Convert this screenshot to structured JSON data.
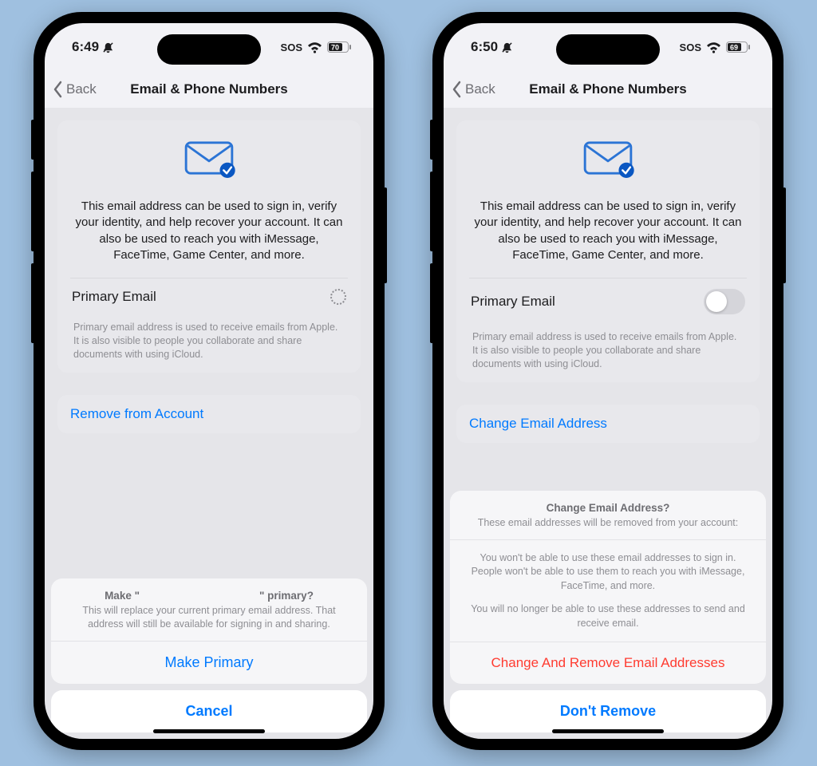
{
  "left": {
    "status": {
      "time": "6:49",
      "sos": "SOS",
      "battery": "70"
    },
    "nav": {
      "back": "Back",
      "title": "Email & Phone Numbers"
    },
    "card": {
      "desc": "This email address can be used to sign in, verify your identity, and help recover your account. It can also be used to reach you with iMessage, FaceTime, Game Center, and more.",
      "row_label": "Primary Email",
      "footer": "Primary email address is used to receive emails from Apple. It is also visible to people you collaborate and share documents with using iCloud."
    },
    "link": "Remove from Account",
    "sheet": {
      "title": "Make \"                                        \" primary?",
      "sub": "This will replace your current primary email address. That address will still be available for signing in and sharing.",
      "confirm": "Make Primary",
      "cancel": "Cancel"
    }
  },
  "right": {
    "status": {
      "time": "6:50",
      "sos": "SOS",
      "battery": "69"
    },
    "nav": {
      "back": "Back",
      "title": "Email & Phone Numbers"
    },
    "card": {
      "desc": "This email address can be used to sign in, verify your identity, and help recover your account. It can also be used to reach you with iMessage, FaceTime, Game Center, and more.",
      "row_label": "Primary Email",
      "footer": "Primary email address is used to receive emails from Apple. It is also visible to people you collaborate and share documents with using iCloud."
    },
    "link": "Change Email Address",
    "sheet": {
      "title": "Change Email Address?",
      "sub": "These email addresses will be removed from your account:",
      "body1": "You won't be able to use these email addresses to sign in. People won't be able to use them to reach you with iMessage, FaceTime, and more.",
      "body2": "You will no longer be able to use these addresses to send and receive email.",
      "confirm": "Change And Remove Email Addresses",
      "cancel": "Don't Remove"
    }
  }
}
